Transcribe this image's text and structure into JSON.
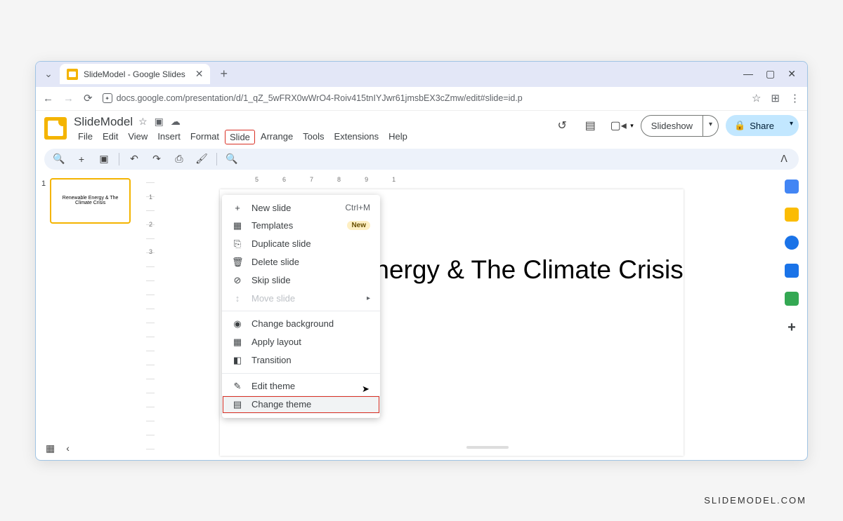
{
  "browser": {
    "tab_title": "SlideModel - Google Slides",
    "url": "docs.google.com/presentation/d/1_qZ_5wFRX0wWrO4-Roiv415tnIYJwr61jmsbEX3cZmw/edit#slide=id.p"
  },
  "doc": {
    "title": "SlideModel"
  },
  "menu": {
    "items": [
      "File",
      "Edit",
      "View",
      "Insert",
      "Format",
      "Slide",
      "Arrange",
      "Tools",
      "Extensions",
      "Help"
    ],
    "active": "Slide"
  },
  "header_buttons": {
    "slideshow": "Slideshow",
    "share": "Share"
  },
  "dropdown": {
    "new_slide": "New slide",
    "new_slide_shortcut": "Ctrl+M",
    "templates": "Templates",
    "templates_badge": "New",
    "duplicate": "Duplicate slide",
    "delete": "Delete slide",
    "skip": "Skip slide",
    "move": "Move slide",
    "change_bg": "Change background",
    "apply_layout": "Apply layout",
    "transition": "Transition",
    "edit_theme": "Edit theme",
    "change_theme": "Change theme"
  },
  "slide": {
    "title": "Renewable Energy & The Climate Crisis",
    "thumb_text": "Renewable Energy & The Climate Crisis",
    "thumb_num": "1"
  },
  "ruler_h": [
    "5",
    "6",
    "7",
    "8",
    "9",
    "1"
  ],
  "ruler_v": [
    "1",
    "2",
    "3"
  ],
  "watermark": "SLIDEMODEL.COM"
}
